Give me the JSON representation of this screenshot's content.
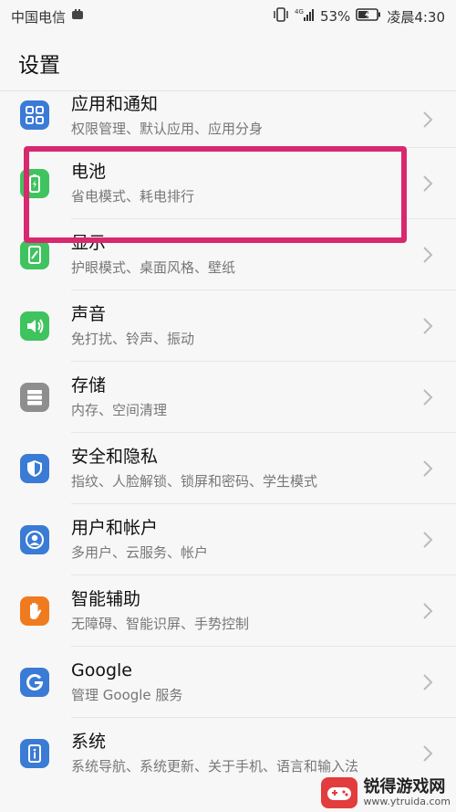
{
  "status_bar": {
    "carrier": "中国电信",
    "battery_pct": "53%",
    "time": "凌晨4:30",
    "network": "4G"
  },
  "page_title": "设置",
  "items": [
    {
      "title": "应用和通知",
      "subtitle": "权限管理、默认应用、应用分身",
      "icon": "apps-grid-icon",
      "color": "#3a7bd5"
    },
    {
      "title": "电池",
      "subtitle": "省电模式、耗电排行",
      "icon": "battery-icon",
      "color": "#3fc35f"
    },
    {
      "title": "显示",
      "subtitle": "护眼模式、桌面风格、壁纸",
      "icon": "display-icon",
      "color": "#3fc35f"
    },
    {
      "title": "声音",
      "subtitle": "免打扰、铃声、振动",
      "icon": "speaker-icon",
      "color": "#3fc35f"
    },
    {
      "title": "存储",
      "subtitle": "内存、空间清理",
      "icon": "storage-icon",
      "color": "#8e8e8e"
    },
    {
      "title": "安全和隐私",
      "subtitle": "指纹、人脸解锁、锁屏和密码、学生模式",
      "icon": "shield-icon",
      "color": "#3a7bd5"
    },
    {
      "title": "用户和帐户",
      "subtitle": "多用户、云服务、帐户",
      "icon": "user-icon",
      "color": "#3a7bd5"
    },
    {
      "title": "智能辅助",
      "subtitle": "无障碍、智能识屏、手势控制",
      "icon": "hand-icon",
      "color": "#f07b1f"
    },
    {
      "title": "Google",
      "subtitle": "管理 Google 服务",
      "icon": "google-icon",
      "color": "#3a7bd5"
    },
    {
      "title": "系统",
      "subtitle": "系统导航、系统更新、关于手机、语言和输入法",
      "icon": "info-icon",
      "color": "#3a7bd5"
    }
  ],
  "watermark": {
    "title": "锐得游戏网",
    "url": "www.ytruida.com"
  }
}
